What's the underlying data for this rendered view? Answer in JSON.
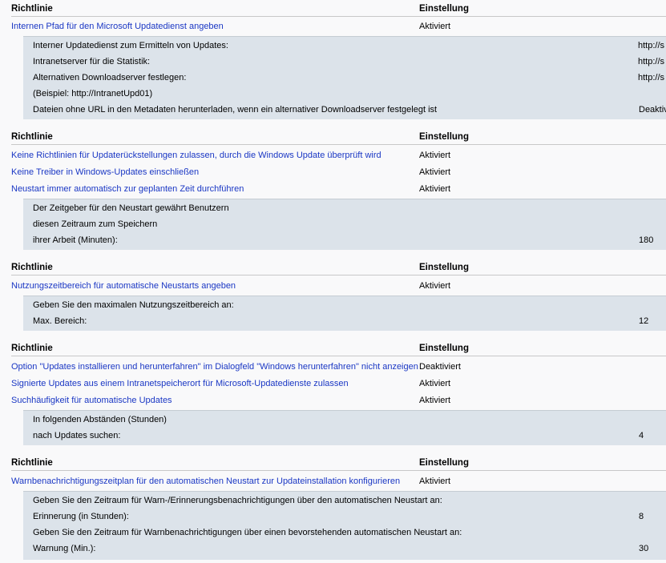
{
  "col_policy": "Richtlinie",
  "col_setting": "Einstellung",
  "s1": {
    "rows": [
      {
        "name": "Internen Pfad für den Microsoft Updatedienst angeben",
        "value": "Aktiviert"
      }
    ],
    "details": [
      {
        "label": "Interner Updatedienst zum Ermitteln von Updates:",
        "value": "http://s"
      },
      {
        "label": "Intranetserver für die Statistik:",
        "value": "http://s"
      },
      {
        "label": "Alternativen Downloadserver festlegen:",
        "value": "http://s"
      },
      {
        "label": "(Beispiel: http://IntranetUpd01)",
        "value": ""
      },
      {
        "label": "Dateien ohne URL in den Metadaten herunterladen, wenn ein alternativer Downloadserver festgelegt ist",
        "value": "Deaktiv"
      }
    ]
  },
  "s2": {
    "rows": [
      {
        "name": "Keine Richtlinien für Updaterückstellungen zulassen, durch die Windows Update überprüft wird",
        "value": "Aktiviert"
      },
      {
        "name": "Keine Treiber in Windows-Updates einschließen",
        "value": "Aktiviert"
      },
      {
        "name": "Neustart immer automatisch zur geplanten Zeit durchführen",
        "value": "Aktiviert"
      }
    ],
    "details": [
      {
        "label": "Der Zeitgeber für den Neustart gewährt Benutzern",
        "value": ""
      },
      {
        "label": "diesen Zeitraum zum Speichern",
        "value": ""
      },
      {
        "label": "ihrer Arbeit (Minuten):",
        "value": "180"
      }
    ]
  },
  "s3": {
    "rows": [
      {
        "name": "Nutzungszeitbereich für automatische Neustarts angeben",
        "value": "Aktiviert"
      }
    ],
    "details": [
      {
        "label": "Geben Sie den maximalen Nutzungszeitbereich an:",
        "value": ""
      },
      {
        "label": "Max. Bereich:",
        "value": "12"
      }
    ]
  },
  "s4": {
    "rows": [
      {
        "name": "Option \"Updates installieren und herunterfahren\" im Dialogfeld \"Windows herunterfahren\" nicht anzeigen",
        "value": "Deaktiviert"
      },
      {
        "name": "Signierte Updates aus einem Intranetspeicherort für Microsoft-Updatedienste zulassen",
        "value": "Aktiviert"
      },
      {
        "name": "Suchhäufigkeit für automatische Updates",
        "value": "Aktiviert"
      }
    ],
    "details": [
      {
        "label": "In folgenden Abständen (Stunden)",
        "value": ""
      },
      {
        "label": "nach Updates suchen:",
        "value": "4"
      }
    ]
  },
  "s5": {
    "rows": [
      {
        "name": "Warnbenachrichtigungszeitplan für den automatischen Neustart zur Updateinstallation konfigurieren",
        "value": "Aktiviert"
      }
    ],
    "details": [
      {
        "label": "Geben Sie den Zeitraum für Warn-/Erinnerungsbenachrichtigungen über den automatischen Neustart an:",
        "value": ""
      },
      {
        "label": "Erinnerung (in Stunden):",
        "value": "8"
      },
      {
        "label": "Geben Sie den Zeitraum für Warnbenachrichtigungen über einen bevorstehenden automatischen Neustart an:",
        "value": ""
      },
      {
        "label": "Warnung (Min.):",
        "value": "30"
      }
    ]
  }
}
